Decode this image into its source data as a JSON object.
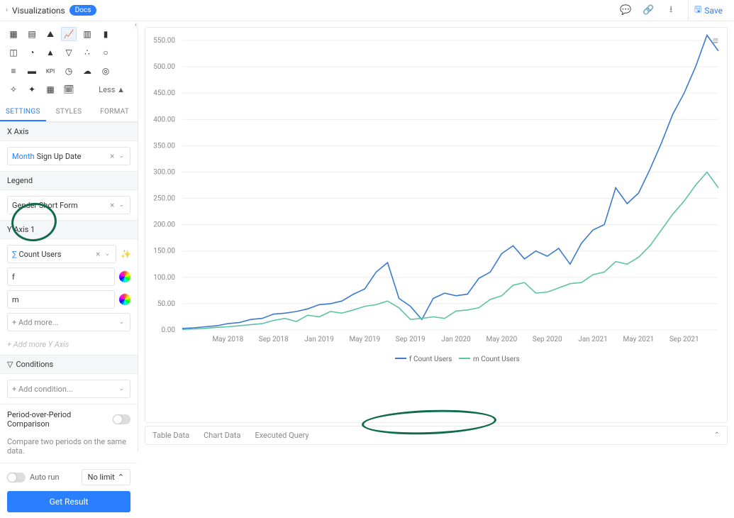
{
  "header": {
    "title": "Visualizations",
    "badge": "Docs",
    "save": "Save"
  },
  "sidebar": {
    "less": "Less ▲",
    "tabs": [
      "SETTINGS",
      "STYLES",
      "FORMAT"
    ],
    "xaxis": {
      "header": "X Axis",
      "prefix": "Month",
      "value": "Sign Up Date"
    },
    "legend": {
      "header": "Legend",
      "value": "Gender Short Form"
    },
    "yaxis": {
      "header": "Y Axis 1",
      "metric_prefix": "∑",
      "metric": "Count Users",
      "series": [
        "f",
        "m"
      ],
      "addmore": "+ Add more...",
      "addaxis": "+ Add more Y Axis"
    },
    "conditions": {
      "header": "Conditions",
      "add": "+ Add condition..."
    },
    "pop": {
      "header": "Period-over-Period Comparison",
      "desc": "Compare two periods on the same data."
    },
    "autorun": "Auto run",
    "limit": "No limit",
    "getresult": "Get Result"
  },
  "datatabs": [
    "Table Data",
    "Chart Data",
    "Executed Query"
  ],
  "chart_data": {
    "type": "line",
    "title": "",
    "xlabel": "",
    "ylabel": "",
    "ylim": [
      0,
      550
    ],
    "yticks": [
      0,
      50,
      100,
      150,
      200,
      250,
      300,
      350,
      400,
      450,
      500,
      550
    ],
    "categories": [
      "Jan 2018",
      "Feb 2018",
      "Mar 2018",
      "Apr 2018",
      "May 2018",
      "Jun 2018",
      "Jul 2018",
      "Aug 2018",
      "Sep 2018",
      "Oct 2018",
      "Nov 2018",
      "Dec 2018",
      "Jan 2019",
      "Feb 2019",
      "Mar 2019",
      "Apr 2019",
      "May 2019",
      "Jun 2019",
      "Jul 2019",
      "Aug 2019",
      "Sep 2019",
      "Oct 2019",
      "Nov 2019",
      "Dec 2019",
      "Jan 2020",
      "Feb 2020",
      "Mar 2020",
      "Apr 2020",
      "May 2020",
      "Jun 2020",
      "Jul 2020",
      "Aug 2020",
      "Sep 2020",
      "Oct 2020",
      "Nov 2020",
      "Dec 2020",
      "Jan 2021",
      "Feb 2021",
      "Mar 2021",
      "Apr 2021",
      "May 2021",
      "Jun 2021",
      "Jul 2021",
      "Aug 2021",
      "Sep 2021",
      "Oct 2021",
      "Nov 2021",
      "Dec 2021"
    ],
    "xticks": [
      "May 2018",
      "Sep 2018",
      "Jan 2019",
      "May 2019",
      "Sep 2019",
      "Jan 2020",
      "May 2020",
      "Sep 2020",
      "Jan 2021",
      "May 2021",
      "Sep 2021"
    ],
    "series": [
      {
        "name": "f Count Users",
        "color": "#3a7bcf",
        "values": [
          3,
          4,
          6,
          8,
          12,
          14,
          20,
          22,
          30,
          32,
          35,
          40,
          48,
          50,
          55,
          68,
          78,
          110,
          128,
          60,
          45,
          20,
          60,
          70,
          65,
          68,
          98,
          110,
          145,
          160,
          135,
          150,
          140,
          155,
          125,
          165,
          190,
          200,
          270,
          240,
          260,
          305,
          355,
          410,
          450,
          500,
          560,
          530
        ]
      },
      {
        "name": "m Count Users",
        "color": "#5ec2a7",
        "values": [
          1,
          2,
          3,
          5,
          6,
          8,
          10,
          12,
          18,
          22,
          16,
          28,
          25,
          35,
          32,
          38,
          45,
          48,
          55,
          42,
          20,
          22,
          25,
          22,
          36,
          38,
          42,
          58,
          65,
          85,
          90,
          70,
          72,
          80,
          88,
          90,
          105,
          110,
          130,
          125,
          138,
          160,
          190,
          220,
          245,
          275,
          300,
          270
        ]
      }
    ]
  }
}
